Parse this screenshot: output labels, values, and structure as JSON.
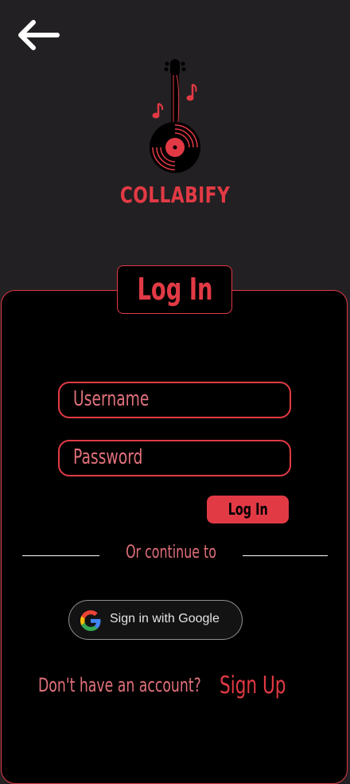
{
  "app": {
    "brand_name": "COLLABIFY"
  },
  "header": {
    "back_icon": "arrow-left-icon"
  },
  "login": {
    "title": "Log In",
    "username_placeholder": "Username",
    "password_placeholder": "Password",
    "submit_label": "Log In",
    "divider_text": "Or continue to",
    "google_label": "Sign in with Google",
    "google_icon": "google-icon",
    "no_account_text": "Don't have an account?",
    "signup_label": "Sign Up"
  },
  "colors": {
    "accent": "#e23a45",
    "background": "#222022",
    "card": "#000000"
  }
}
